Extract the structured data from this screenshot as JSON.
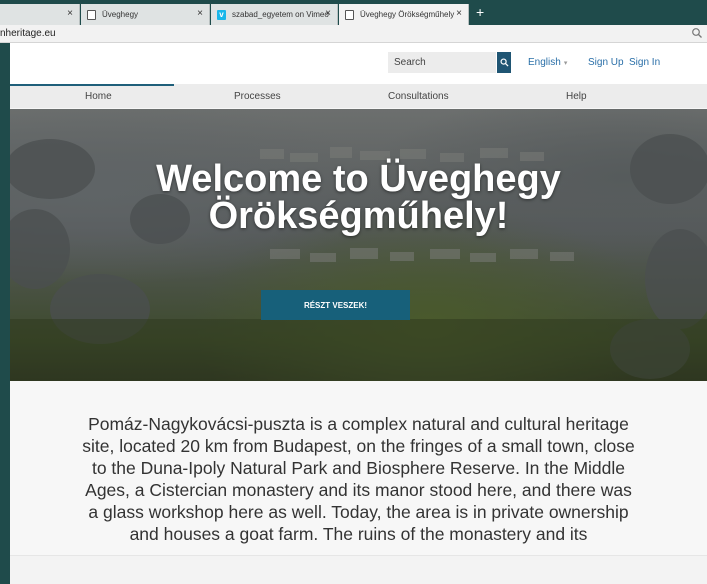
{
  "browser": {
    "tabs": [
      {
        "title": "",
        "active": false
      },
      {
        "title": "Üveghegy",
        "active": false
      },
      {
        "title": "szabad_egyetem on Vimeo",
        "active": false
      },
      {
        "title": "Üveghegy Örökségműhely",
        "active": true
      }
    ],
    "tab_close": "×",
    "new_tab": "+",
    "url": "nheritage.eu"
  },
  "header": {
    "search_placeholder": "Search",
    "language": "English",
    "sign_up": "Sign Up",
    "sign_in": "Sign In"
  },
  "nav": {
    "items": [
      "Home",
      "Processes",
      "Consultations",
      "Help"
    ],
    "active": "Home"
  },
  "hero": {
    "title": "Welcome to Üveghegy Örökségműhely!",
    "cta": "RÉSZT VESZEK!"
  },
  "intro": {
    "text": "Pomáz-Nagykovácsi-puszta is a complex natural and cultural heritage site, located 20 km from Budapest, on the fringes of a small town, close to the Duna-Ipoly Natural Park and Biosphere Reserve. In the Middle Ages, a Cistercian monastery and its manor stood here, and there was a glass workshop here as well. Today, the area is in private ownership and houses a goat farm. The ruins of the monastery and its"
  },
  "colors": {
    "accent": "#17607a",
    "link": "#2a6fa8",
    "search_button": "#1f5573"
  }
}
